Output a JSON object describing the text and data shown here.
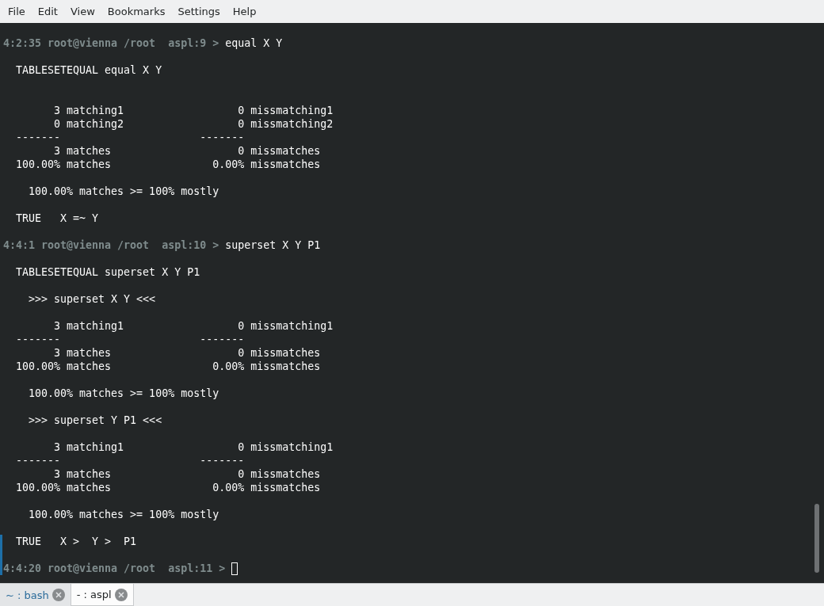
{
  "menu": [
    "File",
    "Edit",
    "View",
    "Bookmarks",
    "Settings",
    "Help"
  ],
  "lines": [
    {
      "kind": "prompt",
      "prompt": "4:2:35 root@vienna /root  aspl:9 >",
      "command": "equal X Y"
    },
    {
      "kind": "blank"
    },
    {
      "kind": "output",
      "text": "  TABLESETEQUAL equal X Y"
    },
    {
      "kind": "blank"
    },
    {
      "kind": "blank"
    },
    {
      "kind": "output",
      "text": "        3 matching1                  0 missmatching1"
    },
    {
      "kind": "output",
      "text": "        0 matching2                  0 missmatching2"
    },
    {
      "kind": "output",
      "text": "  -------                      -------"
    },
    {
      "kind": "output",
      "text": "        3 matches                    0 missmatches"
    },
    {
      "kind": "output",
      "text": "  100.00% matches                0.00% missmatches"
    },
    {
      "kind": "blank"
    },
    {
      "kind": "output",
      "text": "    100.00% matches >= 100% mostly"
    },
    {
      "kind": "blank"
    },
    {
      "kind": "output",
      "text": "  TRUE   X =~ Y"
    },
    {
      "kind": "blank"
    },
    {
      "kind": "prompt",
      "prompt": "4:4:1 root@vienna /root  aspl:10 >",
      "command": "superset X Y P1"
    },
    {
      "kind": "blank"
    },
    {
      "kind": "output",
      "text": "  TABLESETEQUAL superset X Y P1"
    },
    {
      "kind": "blank"
    },
    {
      "kind": "output",
      "text": "    >>> superset X Y <<<"
    },
    {
      "kind": "blank"
    },
    {
      "kind": "output",
      "text": "        3 matching1                  0 missmatching1"
    },
    {
      "kind": "output",
      "text": "  -------                      -------"
    },
    {
      "kind": "output",
      "text": "        3 matches                    0 missmatches"
    },
    {
      "kind": "output",
      "text": "  100.00% matches                0.00% missmatches"
    },
    {
      "kind": "blank"
    },
    {
      "kind": "output",
      "text": "    100.00% matches >= 100% mostly"
    },
    {
      "kind": "blank"
    },
    {
      "kind": "output",
      "text": "    >>> superset Y P1 <<<"
    },
    {
      "kind": "blank"
    },
    {
      "kind": "output",
      "text": "        3 matching1                  0 missmatching1"
    },
    {
      "kind": "output",
      "text": "  -------                      -------"
    },
    {
      "kind": "output",
      "text": "        3 matches                    0 missmatches"
    },
    {
      "kind": "output",
      "text": "  100.00% matches                0.00% missmatches"
    },
    {
      "kind": "blank"
    },
    {
      "kind": "output",
      "text": "    100.00% matches >= 100% mostly"
    },
    {
      "kind": "blank"
    },
    {
      "kind": "output",
      "text": "  TRUE   X >  Y >  P1"
    },
    {
      "kind": "blank"
    },
    {
      "kind": "prompt",
      "prompt": "4:4:20 root@vienna /root  aspl:11 >",
      "cursor": true
    }
  ],
  "tabs": [
    {
      "label": "~ : bash",
      "selected": false
    },
    {
      "label": "- : aspl",
      "selected": true
    }
  ]
}
